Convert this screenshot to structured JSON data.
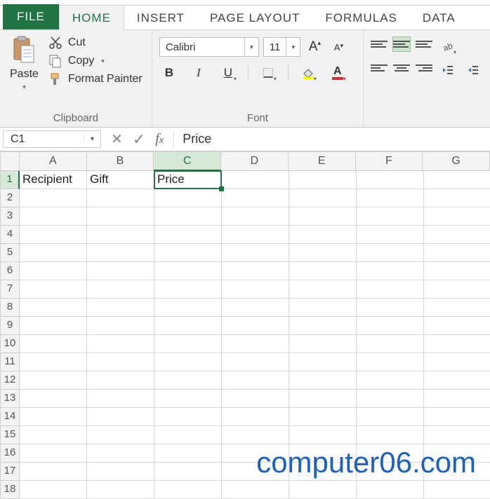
{
  "tabs": {
    "file": "FILE",
    "home": "HOME",
    "insert": "INSERT",
    "page_layout": "PAGE LAYOUT",
    "formulas": "FORMULAS",
    "data": "DATA",
    "active": "home"
  },
  "ribbon": {
    "clipboard": {
      "label": "Clipboard",
      "paste": "Paste",
      "cut": "Cut",
      "copy": "Copy",
      "format_painter": "Format Painter"
    },
    "font": {
      "label": "Font",
      "name": "Calibri",
      "size": "11",
      "bold": "B",
      "italic": "I",
      "underline": "U",
      "font_color_letter": "A",
      "grow": "A",
      "shrink": "A"
    }
  },
  "name_box": "C1",
  "formula_bar": "Price",
  "columns": [
    "A",
    "B",
    "C",
    "D",
    "E",
    "F",
    "G"
  ],
  "rows": [
    "1",
    "2",
    "3",
    "4",
    "5",
    "6",
    "7",
    "8",
    "9",
    "10",
    "11",
    "12",
    "13",
    "14",
    "15",
    "16",
    "17",
    "18"
  ],
  "selected": {
    "col": "C",
    "row": "1"
  },
  "cells": {
    "A1": "Recipient",
    "B1": "Gift",
    "C1": "Price"
  },
  "watermark": "computer06.com",
  "colors": {
    "accent": "#217346",
    "font_color": "#d92b2b",
    "fill_color": "#ffff00"
  }
}
